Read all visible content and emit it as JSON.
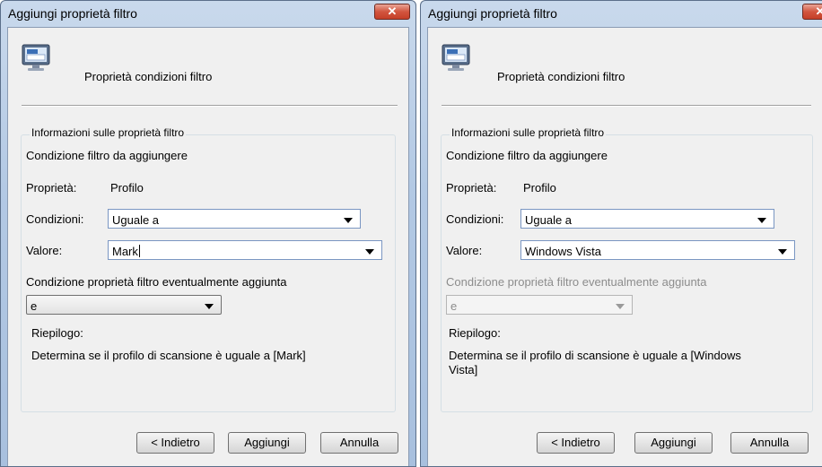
{
  "dialogs": [
    {
      "title": "Aggiungi proprietà filtro",
      "close_glyph": "✕",
      "header_icon": "computer-monitor-icon",
      "header_text": "Proprietà condizioni filtro",
      "group_title": "Informazioni sulle proprietà filtro",
      "section_label": "Condizione filtro da aggiungere",
      "property_label": "Proprietà:",
      "property_value": "Profilo",
      "conditions_label": "Condizioni:",
      "conditions_value": "Uguale a",
      "value_label": "Valore:",
      "value_value": "Mark",
      "combine_label": "Condizione proprietà filtro eventualmente aggiunta",
      "combine_value": "e",
      "combine_enabled": true,
      "summary_label": "Riepilogo:",
      "summary_text": "Determina se il profilo di scansione è uguale a [Mark]",
      "buttons": {
        "back": "< Indietro",
        "add": "Aggiungi",
        "cancel": "Annulla"
      }
    },
    {
      "title": "Aggiungi proprietà filtro",
      "close_glyph": "✕",
      "header_icon": "computer-monitor-icon",
      "header_text": "Proprietà condizioni filtro",
      "group_title": "Informazioni sulle proprietà filtro",
      "section_label": "Condizione filtro da aggiungere",
      "property_label": "Proprietà:",
      "property_value": "Profilo",
      "conditions_label": "Condizioni:",
      "conditions_value": "Uguale a",
      "value_label": "Valore:",
      "value_value": "Windows Vista",
      "combine_label": "Condizione proprietà filtro eventualmente aggiunta",
      "combine_value": "e",
      "combine_enabled": false,
      "summary_label": "Riepilogo:",
      "summary_text_line1": "Determina se il profilo di scansione è uguale a [Windows",
      "summary_text_line2": "Vista]",
      "buttons": {
        "back": "< Indietro",
        "add": "Aggiungi",
        "cancel": "Annulla"
      }
    }
  ]
}
